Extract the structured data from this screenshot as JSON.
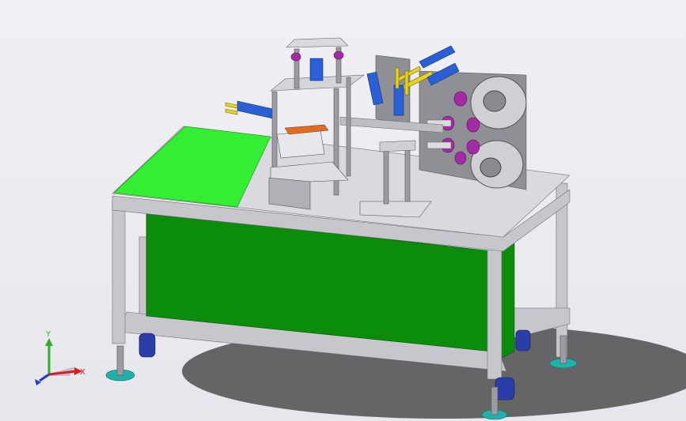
{
  "viewport": {
    "background": "#f0f0f4"
  },
  "triad": {
    "x_label": "X",
    "y_label": "Y",
    "x_color": "#d81e1e",
    "y_color": "#2bb02b",
    "z_color": "#1e3cd8"
  },
  "colors": {
    "frame": "#c6c6cc",
    "frame_dark": "#9b9ba3",
    "top_plate": "#d9d9de",
    "green_panel": "#0b8d0b",
    "green_cover": "#33ee33",
    "caster": "#2b3ea8",
    "foot": "#20b2aa",
    "cylinder": "#2a5fd6",
    "rod": "#e6d21f",
    "roller": "#a52aa5",
    "plate": "#8f8f96"
  },
  "icons": {
    "triad": "coordinate-triad-icon"
  }
}
